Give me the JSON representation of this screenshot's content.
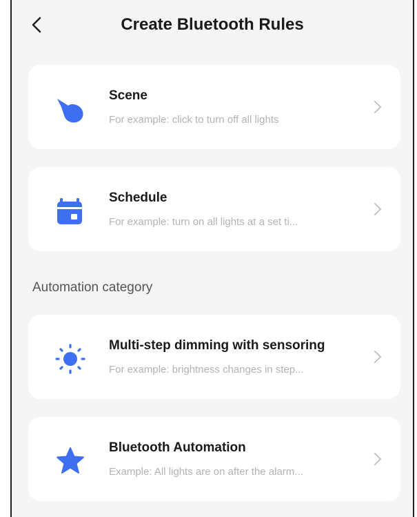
{
  "header": {
    "title": "Create Bluetooth Rules"
  },
  "items": [
    {
      "label": "Scene",
      "description": "For example: click to turn off all lights",
      "icon": "tap-hand-icon"
    },
    {
      "label": "Schedule",
      "description": "For example: turn on all lights at a set ti...",
      "icon": "calendar-icon"
    }
  ],
  "automation": {
    "section_label": "Automation category",
    "items": [
      {
        "label": "Multi-step dimming with sensoring",
        "description": "For example: brightness changes in step...",
        "icon": "sun-icon"
      },
      {
        "label": "Bluetooth Automation",
        "description": "Example: All lights are on after the alarm...",
        "icon": "star-icon"
      }
    ]
  },
  "colors": {
    "accent": "#3d6ff0",
    "background": "#f5f5f5",
    "card": "#ffffff"
  }
}
